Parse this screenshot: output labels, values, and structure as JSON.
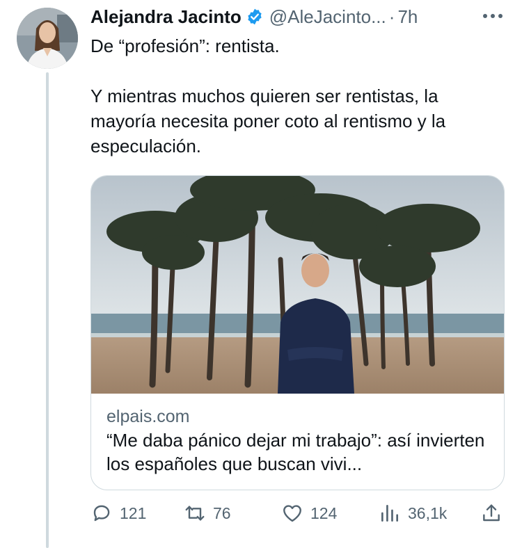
{
  "tweet": {
    "author_name": "Alejandra Jacinto",
    "handle": "@AleJacinto...",
    "separator": "·",
    "time": "7h",
    "text_line1": "De “profesión”: rentista.",
    "text_line2": "Y mientras muchos quieren ser rentistas, la mayoría necesita poner coto al rentismo y la especulación."
  },
  "card": {
    "domain": "elpais.com",
    "headline": "“Me daba pánico dejar mi trabajo”: así invierten los españoles que buscan vivi..."
  },
  "actions": {
    "replies": "121",
    "retweets": "76",
    "likes": "124",
    "views": "36,1k"
  },
  "colors": {
    "verified": "#1d9bf0",
    "secondary_text": "#536471",
    "primary_text": "#0f1419"
  },
  "icons": [
    "verified-badge-icon",
    "more-icon",
    "reply-icon",
    "retweet-icon",
    "like-icon",
    "views-icon",
    "share-icon"
  ]
}
